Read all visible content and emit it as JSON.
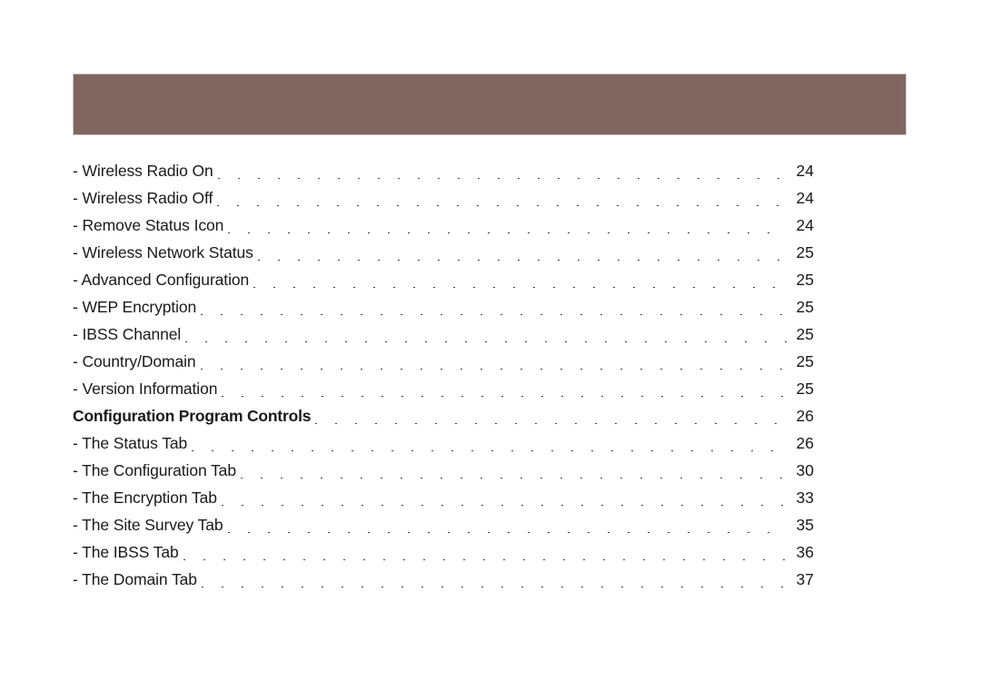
{
  "header": {
    "band_color": "#80665f",
    "band_label": "decorative-header-band"
  },
  "colors": {
    "band": "#80665f",
    "text": "#1a1a1a",
    "background": "#ffffff"
  },
  "toc": {
    "entries": [
      {
        "label": "- Wireless Radio On",
        "page": "24",
        "bold": false
      },
      {
        "label": "- Wireless Radio Off",
        "page": "24",
        "bold": false
      },
      {
        "label": "- Remove Status Icon",
        "page": "24",
        "bold": false
      },
      {
        "label": "- Wireless Network Status",
        "page": "25",
        "bold": false
      },
      {
        "label": "- Advanced Configuration",
        "page": "25",
        "bold": false
      },
      {
        "label": "- WEP Encryption",
        "page": "25",
        "bold": false
      },
      {
        "label": "- IBSS Channel",
        "page": "25",
        "bold": false
      },
      {
        "label": "- Country/Domain",
        "page": "25",
        "bold": false
      },
      {
        "label": "- Version Information",
        "page": "25",
        "bold": false
      },
      {
        "label": "Configuration Program Controls",
        "page": "26",
        "bold": true
      },
      {
        "label": "- The Status Tab",
        "page": "26",
        "bold": false
      },
      {
        "label": "- The Configuration Tab",
        "page": "30",
        "bold": false
      },
      {
        "label": "- The Encryption Tab",
        "page": "33",
        "bold": false
      },
      {
        "label": "- The Site Survey Tab",
        "page": "35",
        "bold": false
      },
      {
        "label": "- The IBSS Tab",
        "page": "36",
        "bold": false
      },
      {
        "label": "- The Domain Tab",
        "page": "37",
        "bold": false
      }
    ]
  }
}
